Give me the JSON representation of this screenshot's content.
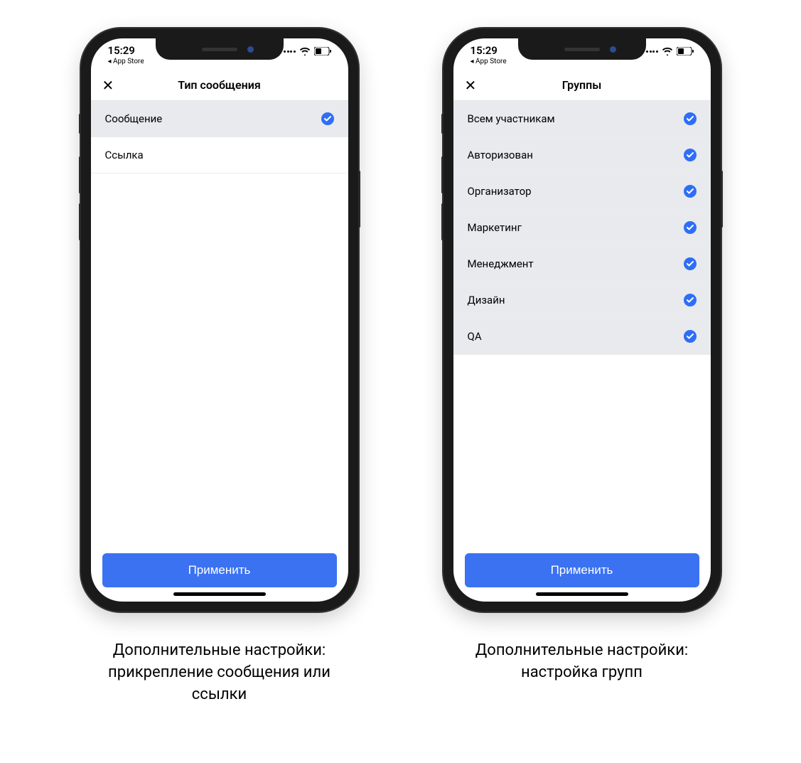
{
  "status": {
    "time": "15:29",
    "back": "◂ App Store"
  },
  "phone1": {
    "title": "Тип сообщения",
    "items": [
      {
        "label": "Сообщение",
        "selected": true
      },
      {
        "label": "Ссылка",
        "selected": false
      }
    ],
    "apply": "Применить",
    "caption": "Дополнительные настройки: прикрепление сообщения или ссылки"
  },
  "phone2": {
    "title": "Группы",
    "items": [
      {
        "label": "Всем участникам",
        "selected": true
      },
      {
        "label": "Авторизован",
        "selected": true
      },
      {
        "label": "Организатор",
        "selected": true
      },
      {
        "label": "Маркетинг",
        "selected": true
      },
      {
        "label": "Менеджмент",
        "selected": true
      },
      {
        "label": "Дизайн",
        "selected": true
      },
      {
        "label": "QA",
        "selected": true
      }
    ],
    "apply": "Применить",
    "caption": "Дополнительные настройки: настройка групп"
  }
}
